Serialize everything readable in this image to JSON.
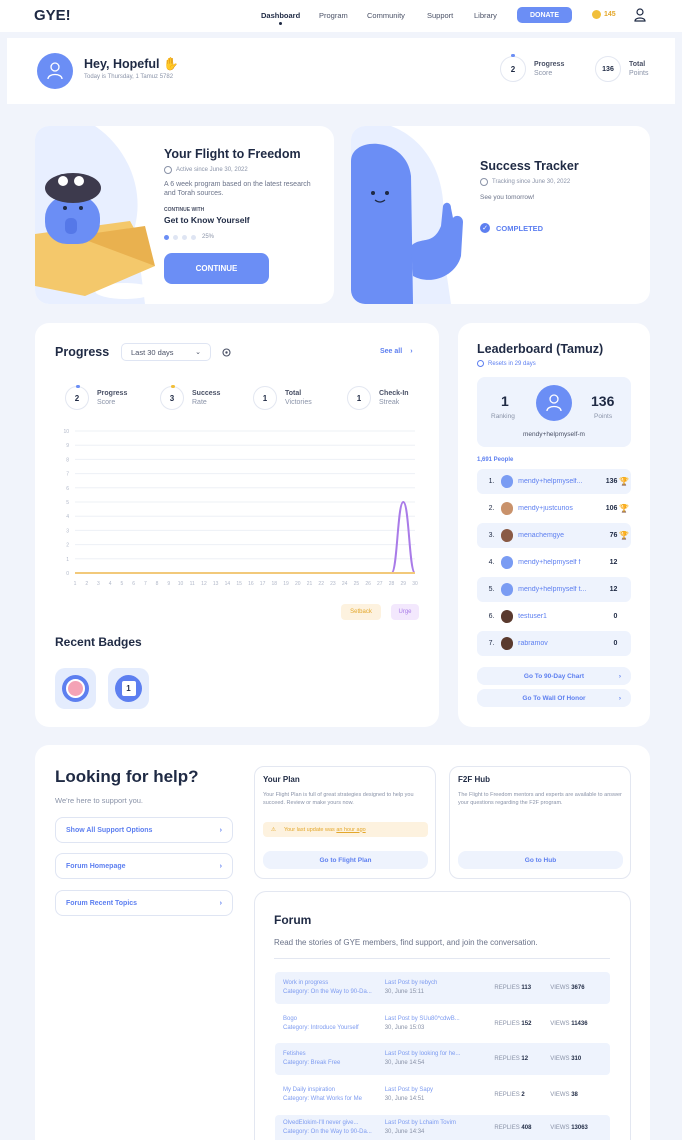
{
  "header": {
    "logo": "GYE!",
    "nav": [
      "Dashboard",
      "Program",
      "Community",
      "Support",
      "Library"
    ],
    "donate": "DONATE",
    "coins": "145"
  },
  "greeting": {
    "title": "Hey, Hopeful",
    "date": "Today is Thursday, 1 Tamuz 5782",
    "progress_value": "2",
    "progress_label": "Progress",
    "progress_sub": "Score",
    "points_value": "136",
    "points_label": "Total",
    "points_sub": "Points"
  },
  "flight": {
    "title": "Your Flight to Freedom",
    "active": "Active since June 30, 2022",
    "desc": "A 6 week program based on the latest research and Torah sources.",
    "continue_with": "CONTINUE WITH",
    "module": "Get to Know Yourself",
    "percent": "25%",
    "progress_fraction": 0.25,
    "button": "CONTINUE"
  },
  "tracker": {
    "title": "Success Tracker",
    "since": "Tracking since June 30, 2022",
    "note": "See you tomorrow!",
    "status": "COMPLETED"
  },
  "progress": {
    "title": "Progress",
    "range": "Last 30 days",
    "see_all": "See all",
    "stats": [
      {
        "value": "2",
        "label": "Progress",
        "sub": "Score"
      },
      {
        "value": "3",
        "label": "Success",
        "sub": "Rate"
      },
      {
        "value": "1",
        "label": "Total",
        "sub": "Victories"
      },
      {
        "value": "1",
        "label": "Check-In",
        "sub": "Streak"
      }
    ],
    "legend": [
      "Setback",
      "Urge"
    ]
  },
  "chart_data": {
    "type": "line",
    "x": [
      1,
      2,
      3,
      4,
      5,
      6,
      7,
      8,
      9,
      10,
      11,
      12,
      13,
      14,
      15,
      16,
      17,
      18,
      19,
      20,
      21,
      22,
      23,
      24,
      25,
      26,
      27,
      28,
      29,
      30
    ],
    "y_ticks": [
      0,
      1,
      2,
      3,
      4,
      5,
      6,
      7,
      8,
      9,
      10
    ],
    "ylim": [
      0,
      10
    ],
    "series": [
      {
        "name": "Urge",
        "color": "#a97be8",
        "values": [
          0,
          0,
          0,
          0,
          0,
          0,
          0,
          0,
          0,
          0,
          0,
          0,
          0,
          0,
          0,
          0,
          0,
          0,
          0,
          0,
          0,
          0,
          0,
          0,
          0,
          0,
          0,
          0,
          5,
          0
        ]
      },
      {
        "name": "Setback",
        "color": "#f2c97a",
        "values": [
          0,
          0,
          0,
          0,
          0,
          0,
          0,
          0,
          0,
          0,
          0,
          0,
          0,
          0,
          0,
          0,
          0,
          0,
          0,
          0,
          0,
          0,
          0,
          0,
          0,
          0,
          0,
          0,
          0,
          0
        ]
      }
    ],
    "grid": true
  },
  "badges": {
    "title": "Recent Badges"
  },
  "leaderboard": {
    "title": "Leaderboard (Tamuz)",
    "resets": "Resets in 29 days",
    "ranking_value": "1",
    "ranking_label": "Ranking",
    "points_value": "136",
    "points_label": "Points",
    "user": "mendy+helpmyself-m",
    "people": "1,691 People",
    "rows": [
      {
        "rank": "1.",
        "name": "mendy+helpmyself...",
        "points": "136",
        "trophy": true
      },
      {
        "rank": "2.",
        "name": "mendy+justcurios",
        "points": "106",
        "trophy": true
      },
      {
        "rank": "3.",
        "name": "menachemgye",
        "points": "76",
        "trophy": true
      },
      {
        "rank": "4.",
        "name": "mendy+helpmyself f",
        "points": "12",
        "trophy": false
      },
      {
        "rank": "5.",
        "name": "mendy+helpmyself t...",
        "points": "12",
        "trophy": false
      },
      {
        "rank": "6.",
        "name": "testuser1",
        "points": "0",
        "trophy": false
      },
      {
        "rank": "7.",
        "name": "rabramov",
        "points": "0",
        "trophy": false
      }
    ],
    "chart_button": "Go To 90-Day Chart",
    "wall_button": "Go To Wall Of Honor"
  },
  "help": {
    "title": "Looking for help?",
    "subtitle": "We're here to support you.",
    "links": [
      "Show All Support Options",
      "Forum Homepage",
      "Forum Recent Topics"
    ]
  },
  "plan": {
    "title": "Your Plan",
    "desc": "Your Flight Plan is full of great strategies designed to help you succeed. Review or make yours now.",
    "warning_prefix": "Your last update was",
    "warning_time": "an hour ago",
    "button": "Go to Flight Plan"
  },
  "hub": {
    "title": "F2F Hub",
    "desc": "The Flight to Freedom mentors and experts are available to answer your questions regarding the F2F program.",
    "button": "Go to Hub"
  },
  "forum": {
    "title": "Forum",
    "desc": "Read the stories of GYE members, find support, and join the conversation.",
    "replies_label": "REPLIES",
    "views_label": "VIEWS",
    "rows": [
      {
        "title": "Work in progress",
        "category": "Category: On the Way to 90-Da...",
        "last": "Last Post by rebych",
        "date": "30, June 15:11",
        "replies": "113",
        "views": "3676"
      },
      {
        "title": "Bogo",
        "category": "Category: Introduce Yourself",
        "last": "Last Post by SUu80*cdwB...",
        "date": "30, June 15:03",
        "replies": "152",
        "views": "11436"
      },
      {
        "title": "Fetishes",
        "category": "Category: Break Free",
        "last": "Last Post by looking for he...",
        "date": "30, June 14:54",
        "replies": "12",
        "views": "310"
      },
      {
        "title": "My Daily inspiration",
        "category": "Category: What Works for Me",
        "last": "Last Post by Sapy",
        "date": "30, June 14:51",
        "replies": "2",
        "views": "38"
      },
      {
        "title": "OlvedElokim-I'll never give...",
        "category": "Category: On the Way to 90-Da...",
        "last": "Last Post by Lchaim Tovim",
        "date": "30, June 14:34",
        "replies": "408",
        "views": "13063"
      }
    ]
  }
}
